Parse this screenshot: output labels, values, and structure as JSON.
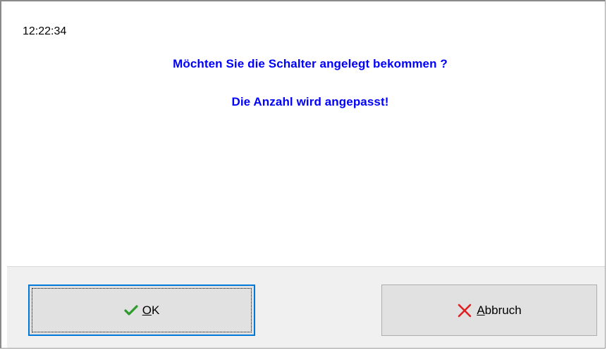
{
  "dialog": {
    "time": "12:22:34",
    "message_line1": "Möchten Sie die Schalter angelegt bekommen ?",
    "message_line2": "Die Anzahl wird angepasst!",
    "message_color": "#0000ff"
  },
  "buttons": {
    "ok": {
      "mnemonic": "O",
      "rest": "K",
      "icon": "check-icon",
      "icon_color": "#2e9a2e"
    },
    "cancel": {
      "mnemonic": "A",
      "rest": "bbruch",
      "icon": "cross-icon",
      "icon_color": "#e02020"
    }
  }
}
